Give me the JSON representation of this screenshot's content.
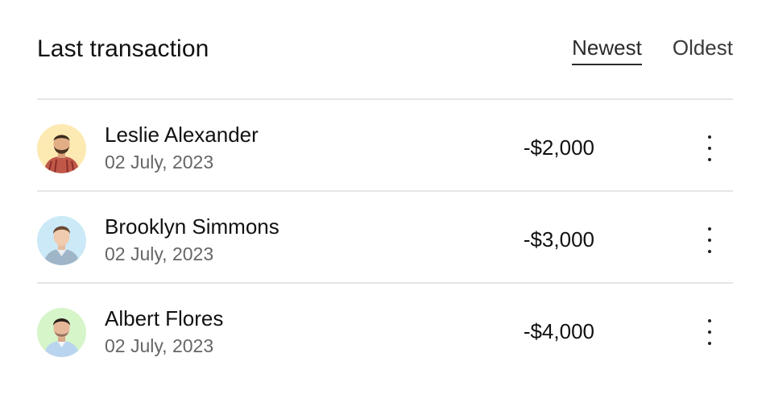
{
  "header": {
    "title": "Last transaction",
    "sort_tabs": [
      {
        "label": "Newest",
        "active": true
      },
      {
        "label": "Oldest",
        "active": false
      }
    ]
  },
  "transactions": [
    {
      "name": "Leslie Alexander",
      "date": "02 July, 2023",
      "amount": "-$2,000",
      "avatar_bg": "#FDEAB3",
      "avatar_icon": "avatar-icon"
    },
    {
      "name": "Brooklyn Simmons",
      "date": "02 July, 2023",
      "amount": "-$3,000",
      "avatar_bg": "#CBE9F7",
      "avatar_icon": "avatar-icon"
    },
    {
      "name": "Albert Flores",
      "date": "02 July, 2023",
      "amount": "-$4,000",
      "avatar_bg": "#D6F5C9",
      "avatar_icon": "avatar-icon"
    }
  ],
  "colors": {
    "divider": "#e5e5e5",
    "text_primary": "#111111",
    "text_secondary": "#666666"
  }
}
